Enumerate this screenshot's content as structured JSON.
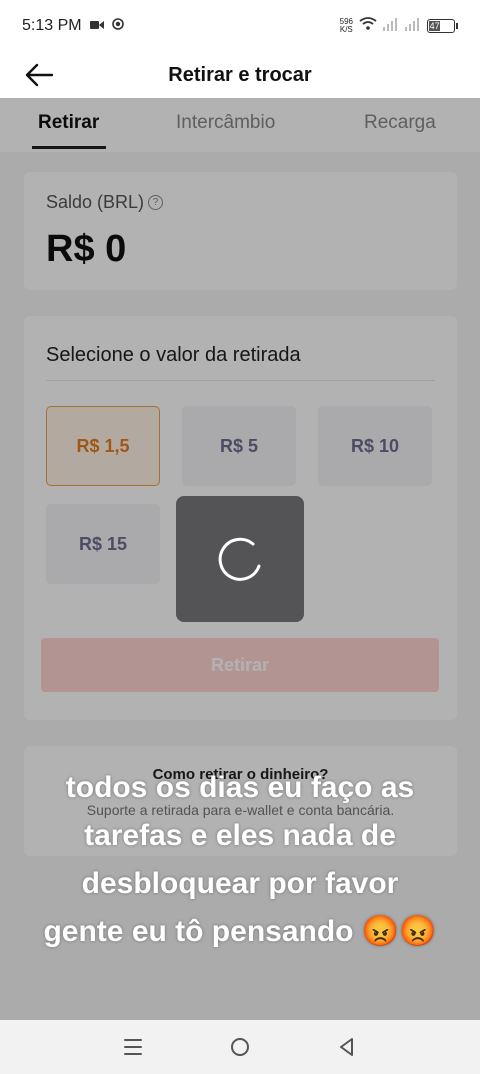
{
  "status_bar": {
    "time": "5:13 PM",
    "netspeed_value": "596",
    "netspeed_unit": "K/S",
    "battery": "47"
  },
  "header": {
    "title": "Retirar e trocar"
  },
  "tabs": [
    {
      "label": "Retirar",
      "active": true
    },
    {
      "label": "Intercâmbio",
      "active": false
    },
    {
      "label": "Recarga",
      "active": false
    }
  ],
  "balance": {
    "label": "Saldo (BRL)",
    "value": "R$ 0"
  },
  "amount": {
    "title": "Selecione o valor da retirada",
    "options": [
      "R$ 1,5",
      "R$ 5",
      "R$ 10",
      "R$ 15"
    ],
    "selected": "R$ 1,5",
    "button_label": "Retirar"
  },
  "help": {
    "title": "Como retirar o dinheiro?",
    "description": "Suporte a retirada para e-wallet e conta bancária."
  },
  "caption": {
    "text": "todos os dias eu faço as tarefas e eles nada de desbloquear por favor gente eu tô pensando 😡😡"
  },
  "colors": {
    "accent": "#e67e22",
    "button_disabled": "#ffd6d3"
  }
}
